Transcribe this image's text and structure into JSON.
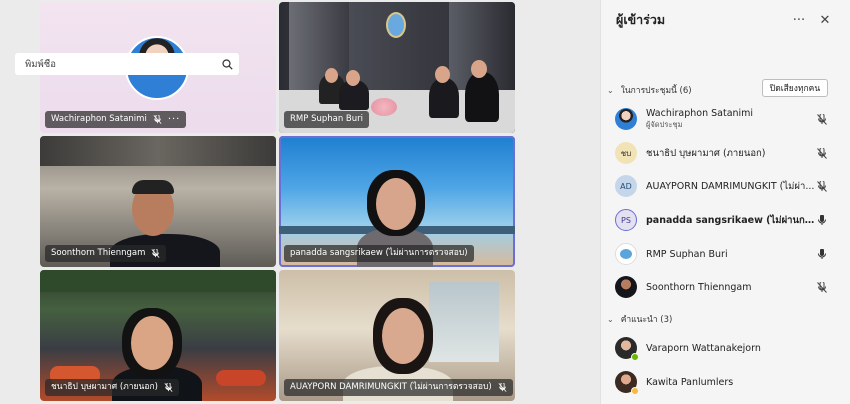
{
  "tiles": [
    {
      "name": "Wachiraphon Satanimi",
      "more": "···"
    },
    {
      "name": "RMP Suphan Buri"
    },
    {
      "name": "Soonthorn Thienngam"
    },
    {
      "name": "panadda sangsrikaew (ไม่ผ่านการตรวจสอบ)"
    },
    {
      "name": "ชนาธิป บุษผามาศ (ภายนอก)"
    },
    {
      "name": "AUAYPORN DAMRIMUNGKIT (ไม่ผ่านการตรวจสอบ)"
    }
  ],
  "panel": {
    "title": "ผู้เข้าร่วม",
    "more": "···",
    "close": "✕",
    "search_placeholder": "พิมพ์ชื่อ",
    "in_meeting": {
      "label": "ในการประชุมนี้ (6)",
      "mute_all": "ปิดเสียงทุกคน",
      "participants": [
        {
          "initials": "",
          "name": "Wachiraphon Satanimi",
          "role": "ผู้จัดประชุม",
          "mic": "muted"
        },
        {
          "initials": "ชบ",
          "name": "ชนาธิป บุษผามาศ (ภายนอก)",
          "role": "",
          "mic": "muted"
        },
        {
          "initials": "AD",
          "name": "AUAYPORN DAMRIMUNGKIT (ไม่ผ่า...",
          "role": "",
          "mic": "muted"
        },
        {
          "initials": "PS",
          "name": "panadda sangsrikaew (ไม่ผ่านการ...",
          "role": "",
          "mic": "on"
        },
        {
          "initials": "",
          "name": "RMP Suphan Buri",
          "role": "",
          "mic": "on"
        },
        {
          "initials": "",
          "name": "Soonthorn Thienngam",
          "role": "",
          "mic": "muted"
        }
      ]
    },
    "suggested": {
      "label": "คำแนะนำ (3)",
      "people": [
        {
          "name": "Varaporn Wattanakejorn",
          "status_color": "#6bb700"
        },
        {
          "name": "Kawita Panlumlers",
          "status_color": "#f8b73e"
        }
      ]
    }
  }
}
